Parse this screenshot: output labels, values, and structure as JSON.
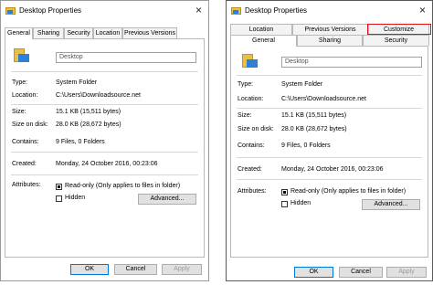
{
  "dialog_left": {
    "title": "Desktop Properties",
    "close_glyph": "×",
    "tabs": [
      "General",
      "Sharing",
      "Security",
      "Location",
      "Previous Versions"
    ],
    "folder_name": "Desktop",
    "type_label": "Type:",
    "type_value": "System Folder",
    "location_label": "Location:",
    "location_value": "C:\\Users\\Downloadsource.net",
    "size_label": "Size:",
    "size_value": "15.1 KB (15,511 bytes)",
    "size_on_disk_label": "Size on disk:",
    "size_on_disk_value": "28.0 KB (28,672 bytes)",
    "contains_label": "Contains:",
    "contains_value": "9 Files, 0 Folders",
    "created_label": "Created:",
    "created_value": "Monday, 24 October 2016, 00:23:06",
    "attributes_label": "Attributes:",
    "readonly_label": "Read-only (Only applies to files in folder)",
    "hidden_label": "Hidden",
    "advanced_label": "Advanced...",
    "ok_label": "OK",
    "cancel_label": "Cancel",
    "apply_label": "Apply"
  },
  "dialog_right": {
    "title": "Desktop Properties",
    "close_glyph": "×",
    "tabs_row1": [
      "Location",
      "Previous Versions",
      "Customize"
    ],
    "tabs_row2": [
      "General",
      "Sharing",
      "Security"
    ],
    "folder_name": "Desktop",
    "type_label": "Type:",
    "type_value": "System Folder",
    "location_label": "Location:",
    "location_value": "C:\\Users\\Downloadsource.net",
    "size_label": "Size:",
    "size_value": "15.1 KB (15,511 bytes)",
    "size_on_disk_label": "Size on disk:",
    "size_on_disk_value": "28.0 KB (28,672 bytes)",
    "contains_label": "Contains:",
    "contains_value": "9 Files, 0 Folders",
    "created_label": "Created:",
    "created_value": "Monday, 24 October 2016, 00:23:06",
    "attributes_label": "Attributes:",
    "readonly_label": "Read-only (Only applies to files in folder)",
    "hidden_label": "Hidden",
    "advanced_label": "Advanced...",
    "ok_label": "OK",
    "cancel_label": "Cancel",
    "apply_label": "Apply"
  },
  "colors": {
    "highlight": "#dd1111",
    "folder_yellow": "#e7bf49",
    "folder_blue": "#2e7fd7",
    "button_face": "#e1e1e1"
  },
  "icons": {
    "title": "folder-icon",
    "main": "folder-icon"
  },
  "attributes_state": {
    "readonly_checked": true,
    "hidden_checked": false
  }
}
